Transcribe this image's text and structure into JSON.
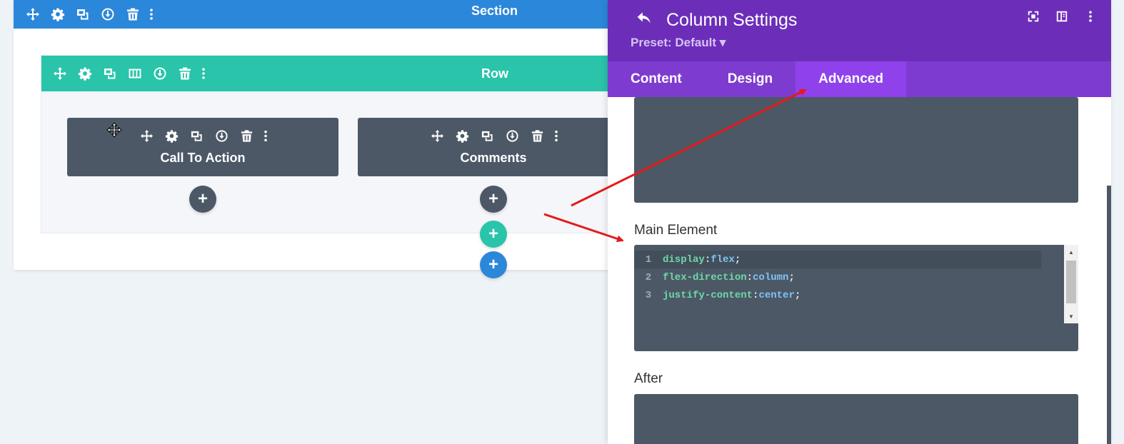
{
  "section": {
    "title": "Section"
  },
  "row": {
    "title": "Row"
  },
  "modules": [
    {
      "title": "Call To Action"
    },
    {
      "title": "Comments"
    }
  ],
  "add_buttons": {
    "symbol": "+"
  },
  "panel": {
    "title": "Column Settings",
    "preset": "Preset: Default ▾",
    "tabs": [
      {
        "label": "Content",
        "active": false
      },
      {
        "label": "Design",
        "active": false
      },
      {
        "label": "Advanced",
        "active": true
      }
    ],
    "fields": {
      "main_element_label": "Main Element",
      "after_label": "After"
    },
    "code": {
      "line_numbers": [
        "1",
        "2",
        "3"
      ],
      "lines": [
        {
          "prop": "display",
          "value": "flex"
        },
        {
          "prop": "flex-direction",
          "value": "column"
        },
        {
          "prop": "justify-content",
          "value": "center"
        }
      ],
      "colon": ": ",
      "semicolon": ";"
    }
  },
  "colors": {
    "section_bar": "#2b87da",
    "row_bar": "#29c4a9",
    "module": "#4c5866",
    "panel_header": "#6c2eb9",
    "tabs_bg": "#7e3bd0",
    "active_tab": "#8f42ec",
    "annotation_arrow": "#e41b1b"
  },
  "icons": [
    "move-icon",
    "gear-icon",
    "duplicate-icon",
    "columns-icon",
    "save-icon",
    "trash-icon",
    "more-icon",
    "back-icon",
    "fullscreen-icon",
    "split-view-icon"
  ]
}
